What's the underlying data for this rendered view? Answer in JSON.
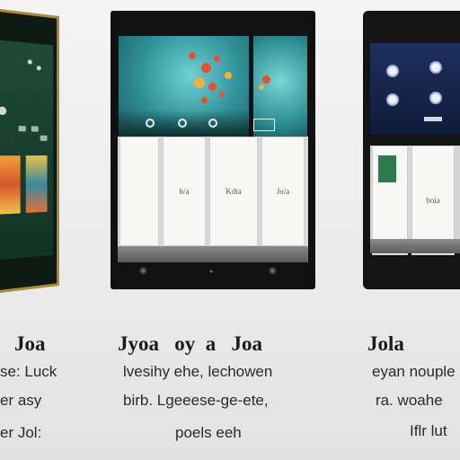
{
  "devices": {
    "center": {
      "panels": [
        "",
        "b/a",
        "Kdta",
        "Jo/a"
      ]
    },
    "right": {
      "panels": [
        "",
        "boia"
      ]
    }
  },
  "captions": {
    "left": {
      "title": "Joa",
      "lines": [
        "se: Luck",
        "er asy",
        "er Jol:"
      ]
    },
    "center": {
      "title": "Jyoa   oy  a   Joa",
      "lines": [
        "lvesihy ehe, lechowen",
        "birb. Lgeeese-ge-ete,",
        "poels eeh"
      ]
    },
    "right": {
      "title": "Jola",
      "lines": [
        "eyan nouple",
        "ra. woahe",
        "Iflr lut"
      ]
    }
  },
  "colors": {
    "gold_frame": "#b08a3a",
    "teal_screen": "#2f8f97",
    "blue_screen": "#1c2f5e",
    "green_screen": "#1f4a39"
  }
}
